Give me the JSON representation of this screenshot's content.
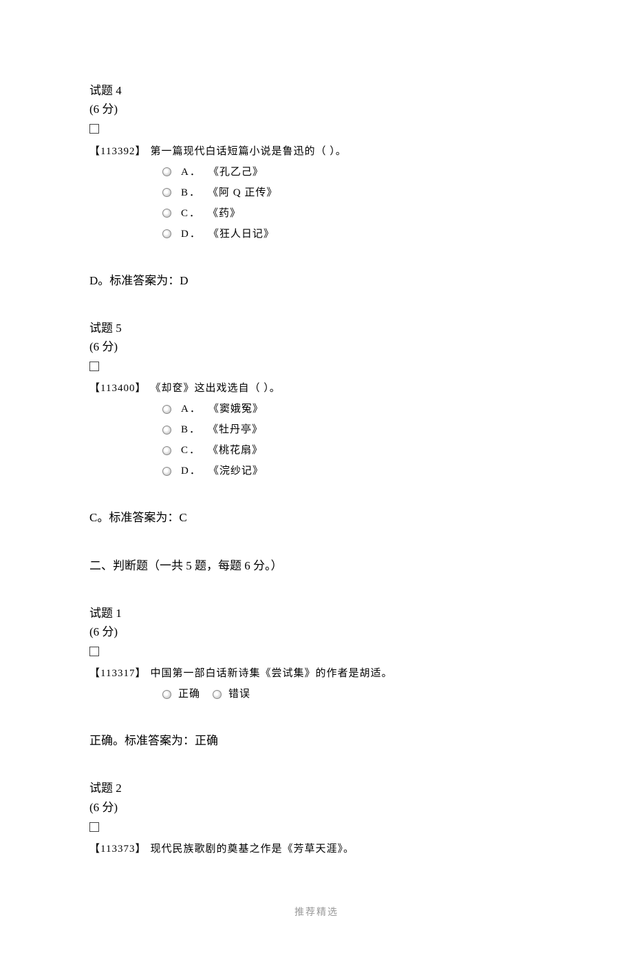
{
  "q4": {
    "label": "试题 4",
    "score": "(6 分)",
    "id": "【113392】",
    "text": "第一篇现代白话短篇小说是鲁迅的（ ）。",
    "options": [
      {
        "letter": "A．",
        "text": "《孔乙己》"
      },
      {
        "letter": "B．",
        "text": "《阿 Q 正传》"
      },
      {
        "letter": "C．",
        "text": "《药》"
      },
      {
        "letter": "D．",
        "text": "《狂人日记》"
      }
    ],
    "answer": "D。标准答案为：D"
  },
  "q5": {
    "label": "试题 5",
    "score": "(6 分)",
    "id": "【113400】",
    "text": "《却奁》这出戏选自（ ）。",
    "options": [
      {
        "letter": "A．",
        "text": "《窦娥冤》"
      },
      {
        "letter": "B．",
        "text": "《牡丹亭》"
      },
      {
        "letter": "C．",
        "text": "《桃花扇》"
      },
      {
        "letter": "D．",
        "text": "《浣纱记》"
      }
    ],
    "answer": "C。标准答案为：C"
  },
  "section2": "二、判断题（一共 5 题，每题 6 分。）",
  "tq1": {
    "label": "试题 1",
    "score": "(6 分)",
    "id": "【113317】",
    "text": "中国第一部白话新诗集《尝试集》的作者是胡适。",
    "true_label": "正确",
    "false_label": "错误",
    "answer": "正确。标准答案为：正确"
  },
  "tq2": {
    "label": "试题 2",
    "score": "(6 分)",
    "id": "【113373】",
    "text": "现代民族歌剧的奠基之作是《芳草天涯》。"
  },
  "footer": "推荐精选"
}
